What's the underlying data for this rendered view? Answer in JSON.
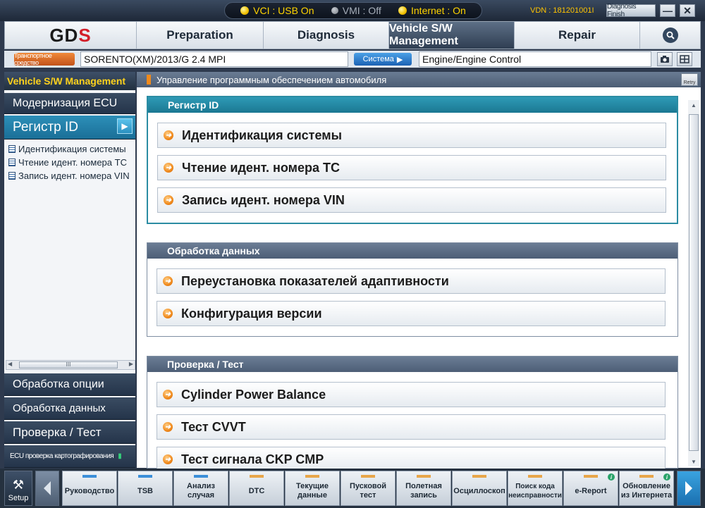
{
  "titlebar": {
    "vci": "VCI : USB On",
    "vmi": "VMI : Off",
    "internet": "Internet : On",
    "vdn": "VDN : 181201001I",
    "diagnosis_finish": "Diagnosis Finish",
    "minimize": "—",
    "close": "✕"
  },
  "nav": {
    "logo_left": "GD",
    "logo_right": "S",
    "tabs": [
      {
        "label": "Preparation"
      },
      {
        "label": "Diagnosis"
      },
      {
        "label": "Vehicle S/W Management"
      },
      {
        "label": "Repair"
      }
    ],
    "active_tab": "Vehicle S/W Management"
  },
  "vehicle_bar": {
    "vehicle_type_label": "Транспортное средство",
    "vehicle": "SORENTO(XM)/2013/G 2.4 MPI",
    "system_label": "Система",
    "system": "Engine/Engine Control"
  },
  "sidebar": {
    "title": "Vehicle S/W Management",
    "items": [
      {
        "label": "Модернизация ECU"
      },
      {
        "label": "Регистр ID"
      }
    ],
    "sub_items": [
      {
        "label": "Идентификация системы"
      },
      {
        "label": "Чтение идент. номера ТС"
      },
      {
        "label": "Запись идент. номера VIN"
      }
    ],
    "scroll_thumb": "III",
    "bottom_items": [
      {
        "label": "Обработка опции"
      },
      {
        "label": "Обработка данных"
      },
      {
        "label": "Проверка / Тест"
      },
      {
        "label": "ECU проверка картографирования"
      }
    ]
  },
  "main": {
    "header": "Управление программным обеспечением автомобиля",
    "retry": "Retry",
    "groups": [
      {
        "title": "Регистр ID",
        "actions": [
          {
            "label": "Идентификация системы"
          },
          {
            "label": "Чтение идент. номера ТС"
          },
          {
            "label": "Запись идент. номера VIN"
          }
        ]
      },
      {
        "title": "Обработка данных",
        "actions": [
          {
            "label": "Переустановка показателей адаптивности"
          },
          {
            "label": "Конфигурация версии"
          }
        ]
      },
      {
        "title": "Проверка / Тест",
        "actions": [
          {
            "label": "Cylinder Power Balance"
          },
          {
            "label": "Тест CVVT"
          },
          {
            "label": "Тест сигнала CKP CMP"
          }
        ]
      }
    ]
  },
  "toolbar": {
    "setup": "Setup",
    "items": [
      {
        "label": "Руководство",
        "color": "#3c8fd8"
      },
      {
        "label": "TSB",
        "color": "#3c8fd8"
      },
      {
        "label": "Анализ\nслучая",
        "color": "#3c8fd8"
      },
      {
        "label": "DTC",
        "color": "#e8a64a"
      },
      {
        "label": "Текущие\nданные",
        "color": "#e8a64a"
      },
      {
        "label": "Пусковой\nтест",
        "color": "#e8a64a"
      },
      {
        "label": "Полетная\nзапись",
        "color": "#e8a64a"
      },
      {
        "label": "Осциллоскоп",
        "color": "#e8a64a"
      },
      {
        "label": "Поиск кода\nнеисправности",
        "color": "#e8a64a"
      },
      {
        "label": "e-Report",
        "color": "#e8a64a"
      },
      {
        "label": "Обновление\nиз Интернета",
        "color": "#e8a64a"
      }
    ]
  }
}
